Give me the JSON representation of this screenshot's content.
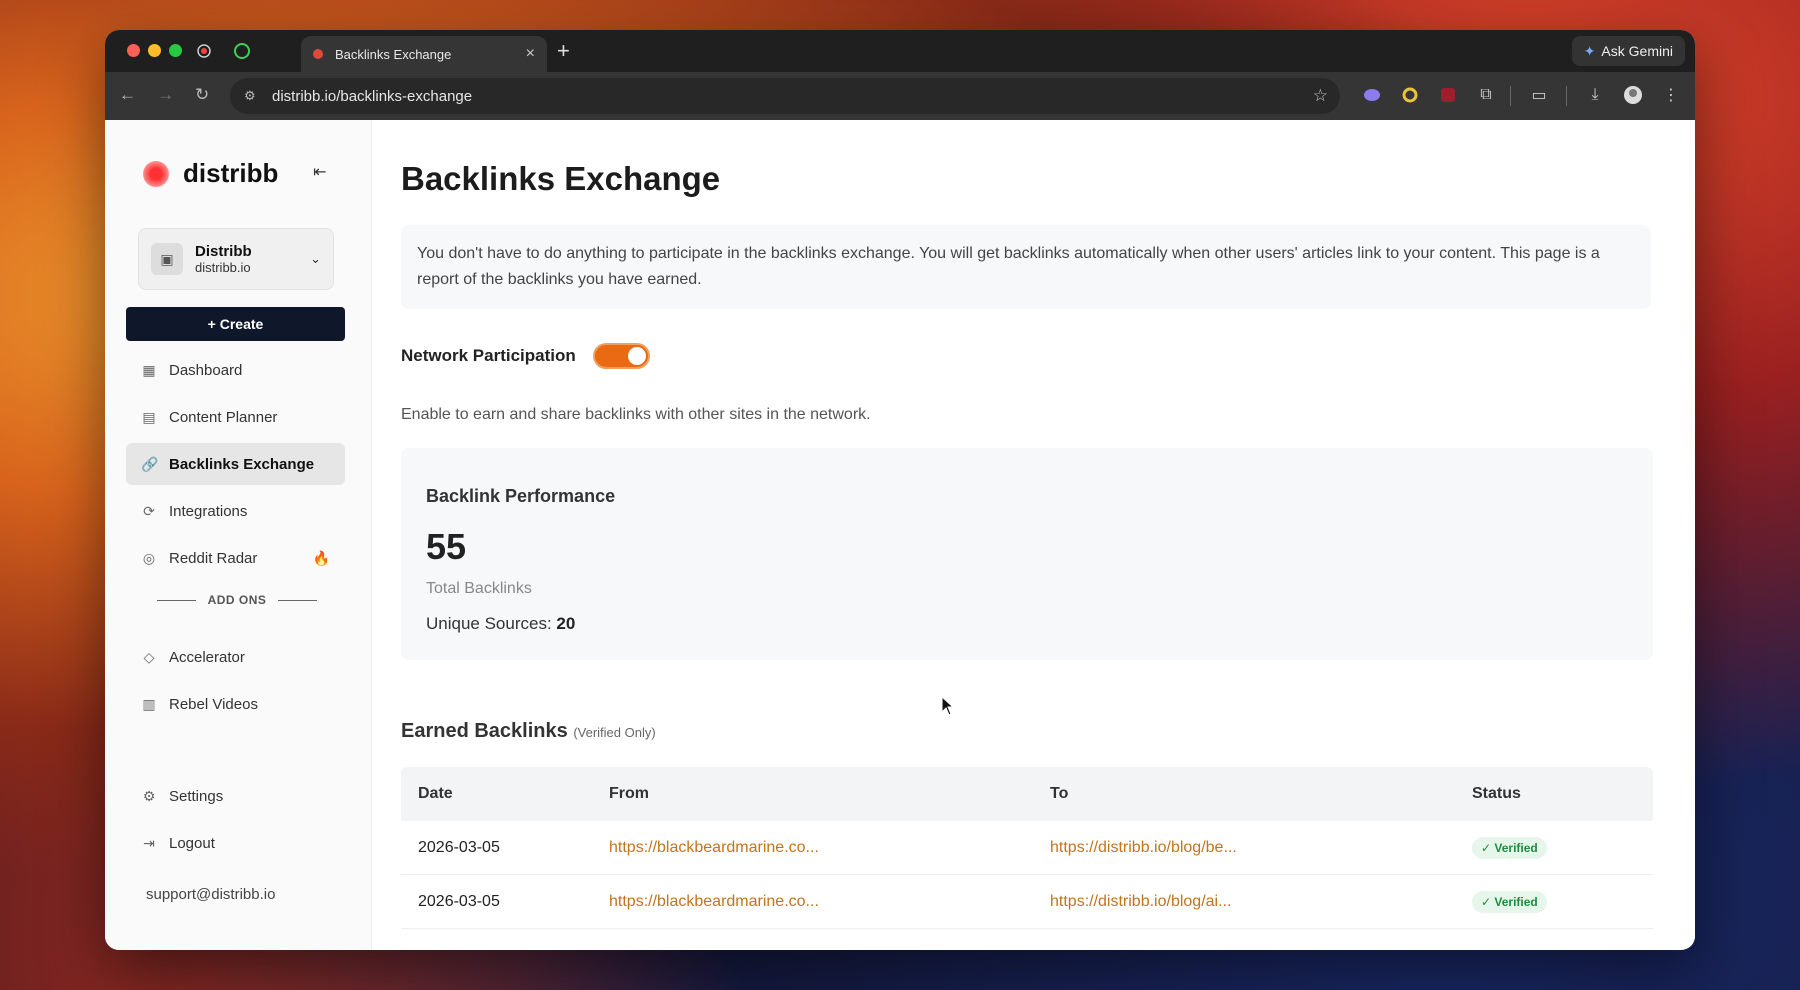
{
  "browser": {
    "tab_title": "Backlinks Exchange",
    "new_tab": "+",
    "ask_gemini": "Ask Gemini",
    "url": "distribb.io/backlinks-exchange"
  },
  "sidebar": {
    "brand": "distribb",
    "workspace_name": "Distribb",
    "workspace_url": "distribb.io",
    "create_label": "+ Create",
    "items": [
      {
        "label": "Dashboard"
      },
      {
        "label": "Content Planner"
      },
      {
        "label": "Backlinks Exchange"
      },
      {
        "label": "Integrations"
      },
      {
        "label": "Reddit Radar"
      }
    ],
    "addons_label": "ADD ONS",
    "addons": [
      {
        "label": "Accelerator"
      },
      {
        "label": "Rebel Videos"
      }
    ],
    "settings_label": "Settings",
    "logout_label": "Logout",
    "support_email": "support@distribb.io"
  },
  "main": {
    "title": "Backlinks Exchange",
    "notice": "You don't have to do anything to participate in the backlinks exchange. You will get backlinks automatically when other users' articles link to your content. This page is a report of the backlinks you have earned.",
    "network_label": "Network Participation",
    "network_enabled": true,
    "network_desc": "Enable to earn and share backlinks with other sites in the network.",
    "performance": {
      "title": "Backlink Performance",
      "total": "55",
      "total_label": "Total Backlinks",
      "unique_label": "Unique Sources:",
      "unique_value": "20"
    },
    "earned_title": "Earned Backlinks",
    "earned_note": "(Verified Only)",
    "table": {
      "headers": [
        "Date",
        "From",
        "To",
        "Status"
      ],
      "rows": [
        {
          "date": "2026-03-05",
          "from": "https://blackbeardmarine.co...",
          "to": "https://distribb.io/blog/be...",
          "status": "Verified"
        },
        {
          "date": "2026-03-05",
          "from": "https://blackbeardmarine.co...",
          "to": "https://distribb.io/blog/ai...",
          "status": "Verified"
        }
      ]
    }
  },
  "colors": {
    "accent": "#ea6a14",
    "link": "#c4741a",
    "verified_bg": "#e6f6ea",
    "verified_text": "#1f8a40",
    "create_bg": "#0f172a"
  }
}
